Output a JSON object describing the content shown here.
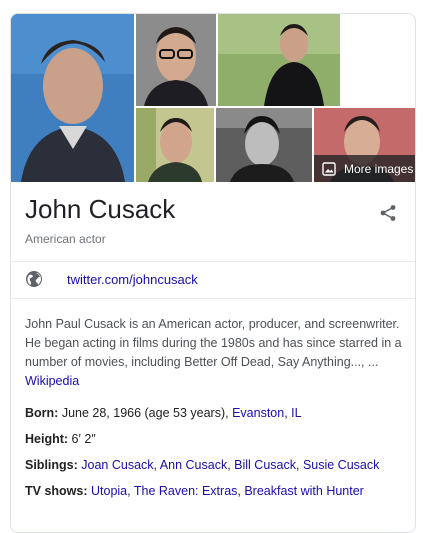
{
  "gallery": {
    "more_images_label": "More images",
    "images": [
      {
        "name": "photo-main",
        "bg": "#3f7fbf"
      },
      {
        "name": "photo-glasses",
        "bg": "#8a8a8a"
      },
      {
        "name": "photo-outdoor",
        "bg": "#7a9a58"
      },
      {
        "name": "photo-green",
        "bg": "#b7b98a"
      },
      {
        "name": "photo-bw",
        "bg": "#6f6f6f"
      },
      {
        "name": "photo-portrait",
        "bg": "#c06060"
      }
    ]
  },
  "header": {
    "title": "John Cusack",
    "subtitle": "American actor"
  },
  "social": {
    "twitter": "twitter.com/johncusack"
  },
  "description": {
    "text": "John Paul Cusack is an American actor, producer, and screenwriter. He began acting in films during the 1980s and has since starred in a number of movies, including Better Off Dead, Say Anything..., ...",
    "source": "Wikipedia"
  },
  "facts": {
    "born_label": "Born:",
    "born_value": "June 28, 1966 (age 53 years),",
    "born_place": "Evanston, IL",
    "height_label": "Height:",
    "height_value": "6′ 2″",
    "siblings_label": "Siblings:",
    "siblings": [
      "Joan Cusack",
      "Ann Cusack",
      "Bill Cusack",
      "Susie Cusack"
    ],
    "tvshows_label": "TV shows:",
    "tvshows": [
      "Utopia",
      "The Raven: Extras",
      "Breakfast with Hunter"
    ]
  },
  "colors": {
    "link": "#1a0dab",
    "muted": "#70757a",
    "title": "#202124"
  }
}
